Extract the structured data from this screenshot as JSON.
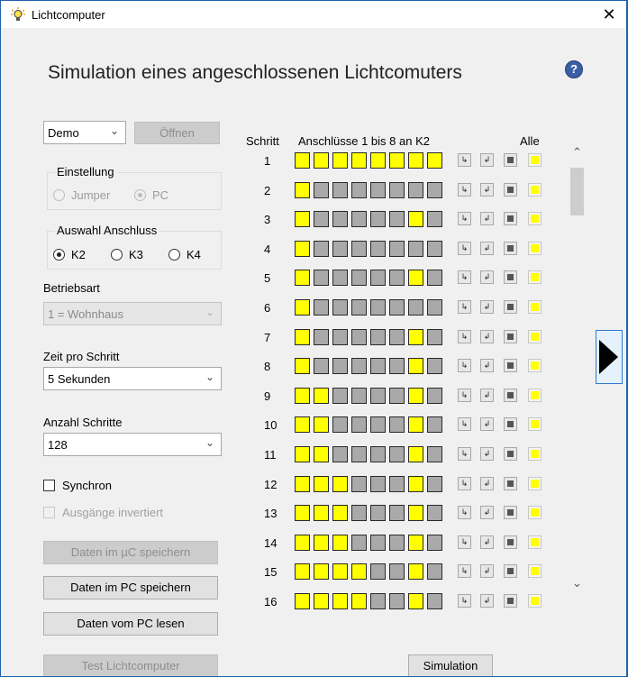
{
  "window": {
    "title": "Lichtcomputer",
    "close_glyph": "✕"
  },
  "heading": "Simulation eines angeschlossenen Lichtcomuters",
  "help_glyph": "?",
  "mode_select": {
    "value": "Demo"
  },
  "open_button": "Öffnen",
  "einstellung": {
    "label": "Einstellung",
    "options": [
      "Jumper",
      "PC"
    ],
    "selected": "PC"
  },
  "anschluss": {
    "label": "Auswahl Anschluss",
    "options": [
      "K2",
      "K3",
      "K4"
    ],
    "selected": "K2"
  },
  "betriebsart": {
    "label": "Betriebsart",
    "value": "1 = Wohnhaus"
  },
  "zeit": {
    "label": "Zeit pro Schritt",
    "value": "5 Sekunden"
  },
  "anzahl": {
    "label": "Anzahl Schritte",
    "value": "128"
  },
  "synchron": {
    "label": "Synchron",
    "checked": false
  },
  "invertiert": {
    "label": "Ausgänge invertiert",
    "checked": false
  },
  "buttons": {
    "save_uc": "Daten im µC speichern",
    "save_pc": "Daten im PC speichern",
    "read_pc": "Daten vom PC lesen",
    "test": "Test Lichtcomputer",
    "simulation": "Simulation"
  },
  "grid": {
    "header_step": "Schritt",
    "header_ports": "Anschlüsse 1 bis 8 an K2",
    "header_all": "Alle",
    "row_button_icons": [
      "shift-left-icon",
      "shift-right-icon",
      "clear-icon",
      "all-on-icon"
    ],
    "colors": {
      "on": "#ffff00",
      "off": "#a9a9a9"
    },
    "rows": [
      {
        "step": "1",
        "leds": [
          1,
          1,
          1,
          1,
          1,
          1,
          1,
          1
        ]
      },
      {
        "step": "2",
        "leds": [
          1,
          0,
          0,
          0,
          0,
          0,
          0,
          0
        ]
      },
      {
        "step": "3",
        "leds": [
          1,
          0,
          0,
          0,
          0,
          0,
          1,
          0
        ]
      },
      {
        "step": "4",
        "leds": [
          1,
          0,
          0,
          0,
          0,
          0,
          0,
          0
        ]
      },
      {
        "step": "5",
        "leds": [
          1,
          0,
          0,
          0,
          0,
          0,
          1,
          0
        ]
      },
      {
        "step": "6",
        "leds": [
          1,
          0,
          0,
          0,
          0,
          0,
          0,
          0
        ]
      },
      {
        "step": "7",
        "leds": [
          1,
          0,
          0,
          0,
          0,
          0,
          1,
          0
        ]
      },
      {
        "step": "8",
        "leds": [
          1,
          0,
          0,
          0,
          0,
          0,
          1,
          0
        ]
      },
      {
        "step": "9",
        "leds": [
          1,
          1,
          0,
          0,
          0,
          0,
          1,
          0
        ]
      },
      {
        "step": "10",
        "leds": [
          1,
          1,
          0,
          0,
          0,
          0,
          1,
          0
        ]
      },
      {
        "step": "11",
        "leds": [
          1,
          1,
          0,
          0,
          0,
          0,
          1,
          0
        ]
      },
      {
        "step": "12",
        "leds": [
          1,
          1,
          1,
          0,
          0,
          0,
          1,
          0
        ]
      },
      {
        "step": "13",
        "leds": [
          1,
          1,
          1,
          0,
          0,
          0,
          1,
          0
        ]
      },
      {
        "step": "14",
        "leds": [
          1,
          1,
          1,
          0,
          0,
          0,
          1,
          0
        ]
      },
      {
        "step": "15",
        "leds": [
          1,
          1,
          1,
          1,
          0,
          0,
          1,
          0
        ]
      },
      {
        "step": "16",
        "leds": [
          1,
          1,
          1,
          1,
          0,
          0,
          1,
          0
        ]
      }
    ]
  }
}
